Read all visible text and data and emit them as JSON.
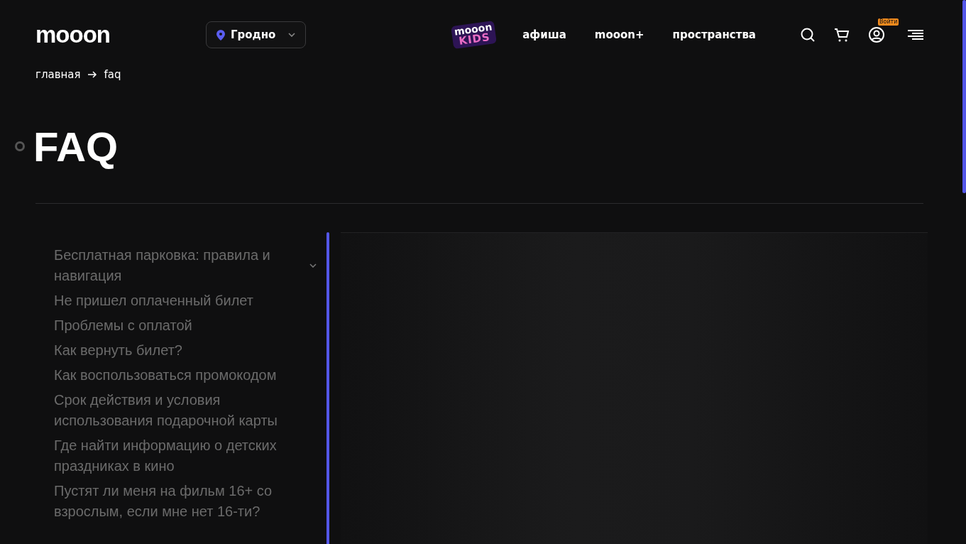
{
  "header": {
    "logo": "mooon",
    "city": "Гродно",
    "kids_logo": {
      "top": "mooon",
      "bottom": "KIDS"
    },
    "nav": [
      "афиша",
      "mooon+",
      "пространства"
    ],
    "login_badge": "Войти"
  },
  "breadcrumbs": [
    "главная",
    "faq"
  ],
  "title": "FAQ",
  "faq_items": [
    {
      "kind": "dropdown",
      "text": "Бесплатная парковка: правила и навигация"
    },
    {
      "kind": "link",
      "text": "Не пришел оплаченный билет"
    },
    {
      "kind": "link",
      "text": "Проблемы с оплатой"
    },
    {
      "kind": "link",
      "text": "Как вернуть билет?"
    },
    {
      "kind": "link",
      "text": "Как воспользоваться промокодом"
    },
    {
      "kind": "link",
      "text": "Срок действия и условия использования подарочной карты"
    },
    {
      "kind": "link",
      "text": "Где найти информацию о детских праздниках в кино"
    },
    {
      "kind": "link",
      "text": "Пустят ли меня на фильм 16+ со взрослым, если мне нет 16-ти?"
    }
  ]
}
